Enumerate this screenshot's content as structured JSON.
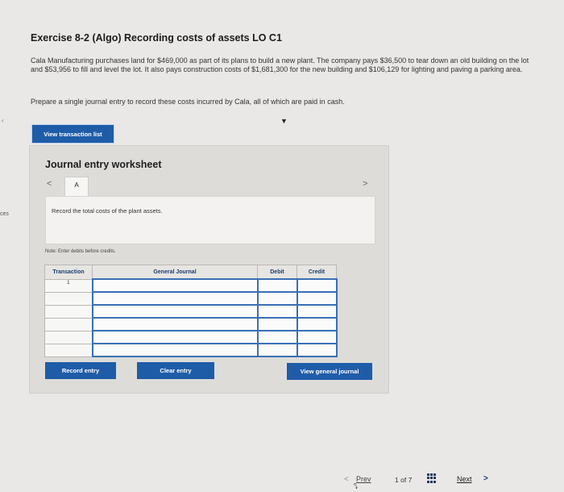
{
  "sidebar_fragment": "ces",
  "exercise_title": "Exercise 8-2 (Algo) Recording costs of assets LO C1",
  "problem_text": "Cala Manufacturing purchases land for $469,000 as part of its plans to build a new plant. The company pays $36,500 to tear down an old building on the lot and $53,956 to fill and level the lot. It also pays construction costs of $1,681,300 for the new building and $106,129 for lighting and paving a parking area.",
  "prepare_text": "Prepare a single journal entry to record these costs incurred by Cala, all of which are paid in cash.",
  "view_transaction_list_label": "View transaction list",
  "worksheet": {
    "title": "Journal entry worksheet",
    "prev_icon": "chevron-left-icon",
    "next_icon": "chevron-right-icon",
    "active_tab": "A",
    "instruction": "Record the total costs of the plant assets.",
    "note": "Note: Enter debits before credits.",
    "columns": [
      "Transaction",
      "General Journal",
      "Debit",
      "Credit"
    ],
    "rows": [
      {
        "transaction": "1",
        "account": "",
        "debit": "",
        "credit": ""
      },
      {
        "transaction": "",
        "account": "",
        "debit": "",
        "credit": ""
      },
      {
        "transaction": "",
        "account": "",
        "debit": "",
        "credit": ""
      },
      {
        "transaction": "",
        "account": "",
        "debit": "",
        "credit": ""
      },
      {
        "transaction": "",
        "account": "",
        "debit": "",
        "credit": ""
      },
      {
        "transaction": "",
        "account": "",
        "debit": "",
        "credit": ""
      }
    ],
    "record_entry_label": "Record entry",
    "clear_entry_label": "Clear entry",
    "view_general_journal_label": "View general journal"
  },
  "pager": {
    "prev_label": "Prev",
    "position": "1",
    "of_label": "of",
    "total": "7",
    "next_label": "Next",
    "grid_icon": "grid-icon"
  },
  "colors": {
    "primary_button": "#1f5ca8",
    "background": "#e9e8e6",
    "panel": "#dddcd9",
    "header_text": "#1d3c6e"
  }
}
